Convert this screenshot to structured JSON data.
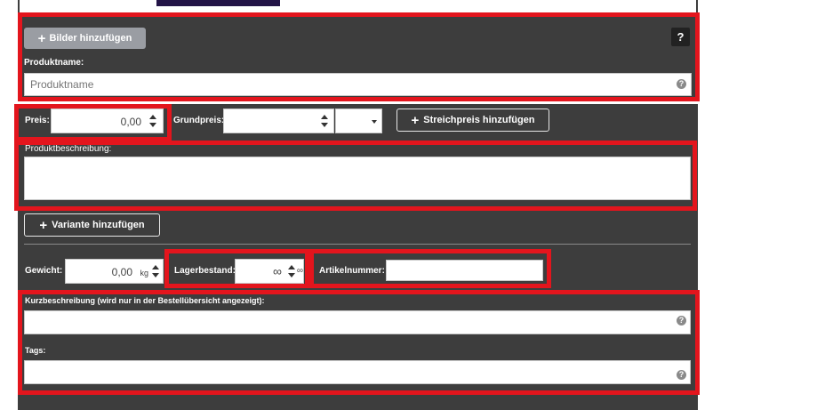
{
  "top": {
    "add_images_label": "Bilder hinzufügen",
    "help_label": "?"
  },
  "product_name": {
    "label": "Produktname:",
    "placeholder": "Produktname",
    "help": "?"
  },
  "price": {
    "label": "Preis:",
    "value": "0,00"
  },
  "base_price": {
    "label": "Grundpreis:",
    "value": "",
    "unit_value": ""
  },
  "strike_price_button": "Streichpreis hinzufügen",
  "description": {
    "label": "Produktbeschreibung:"
  },
  "variant_button": "Variante hinzufügen",
  "weight": {
    "label": "Gewicht:",
    "value": "0,00",
    "unit": "kg"
  },
  "stock": {
    "label": "Lagerbestand:",
    "value": "∞",
    "suffix": "∞"
  },
  "sku": {
    "label": "Artikelnummer:",
    "value": ""
  },
  "short_description": {
    "label": "Kurzbeschreibung (wird nur in der Bestellübersicht angezeigt):",
    "help": "?"
  },
  "tags": {
    "label": "Tags:",
    "help": "?"
  },
  "colors": {
    "panel": "#3d3d3d",
    "highlight": "#e3151d",
    "header_bar": "#231447",
    "button_gray": "#9a9da3"
  }
}
